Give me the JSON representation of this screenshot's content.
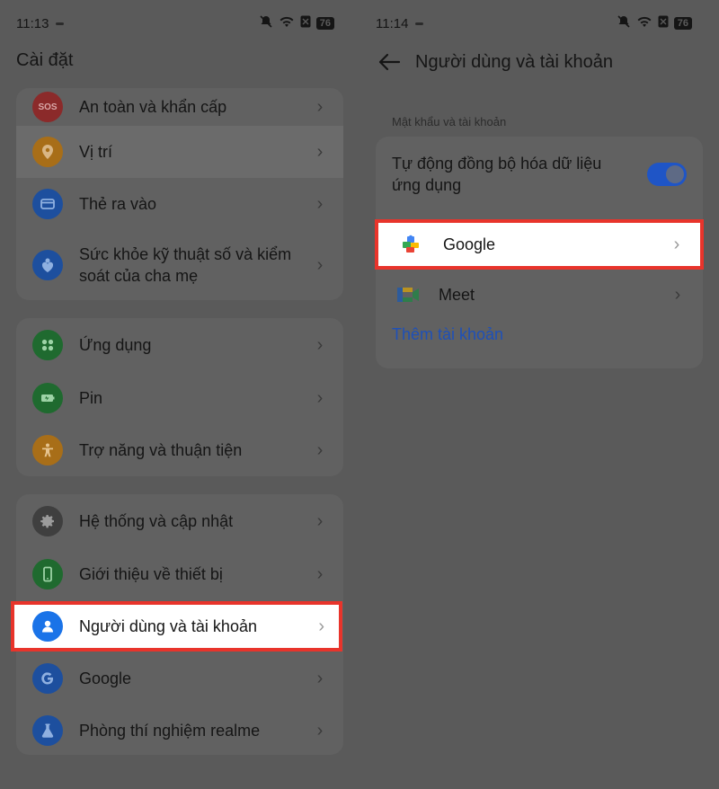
{
  "left": {
    "status": {
      "time": "11:13",
      "battery": "76"
    },
    "title": "Cài đặt",
    "group1": [
      {
        "label": "An toàn và khẩn cấp",
        "icon": "sos-icon",
        "icon_text": "SOS",
        "color": "#8b2a2a"
      },
      {
        "label": "Vị trí",
        "icon": "location-pin-icon",
        "color": "#a86e18"
      },
      {
        "label": "Thẻ ra vào",
        "icon": "card-icon",
        "color": "#1d4f9e"
      },
      {
        "label": "Sức khỏe kỹ thuật số và kiểm soát của cha mẹ",
        "icon": "heart-person-icon",
        "color": "#1d4f9e"
      }
    ],
    "group2": [
      {
        "label": "Ứng dụng",
        "icon": "apps-grid-icon",
        "color": "#1f6a2f"
      },
      {
        "label": "Pin",
        "icon": "battery-icon",
        "color": "#1f6a2f"
      },
      {
        "label": "Trợ năng và thuận tiện",
        "icon": "accessibility-icon",
        "color": "#a86e18"
      }
    ],
    "group3": [
      {
        "label": "Hệ thống và cập nhật",
        "icon": "gear-icon",
        "color": "#3f3f3f"
      },
      {
        "label": "Giới thiệu về thiết bị",
        "icon": "phone-icon",
        "color": "#1f6a2f"
      },
      {
        "label": "Người dùng và tài khoản",
        "icon": "user-icon",
        "color": "#1a73e8"
      },
      {
        "label": "Google",
        "icon": "google-icon",
        "color": "#1d4f9e"
      },
      {
        "label": "Phòng thí nghiệm realme",
        "icon": "flask-icon",
        "color": "#1d4f9e"
      }
    ]
  },
  "right": {
    "status": {
      "time": "11:14",
      "battery": "76"
    },
    "title": "Người dùng và tài khoản",
    "section_label": "Mật khẩu và tài khoản",
    "sync_label": "Tự động đồng bộ hóa dữ liệu ứng dụng",
    "sync_enabled": true,
    "accounts": [
      {
        "label": "Google",
        "icon": "google-puzzle-icon"
      },
      {
        "label": "Meet",
        "icon": "meet-icon"
      }
    ],
    "add_account": "Thêm tài khoản"
  },
  "colors": {
    "highlight_border": "#e8342b",
    "accent": "#1a73e8"
  }
}
